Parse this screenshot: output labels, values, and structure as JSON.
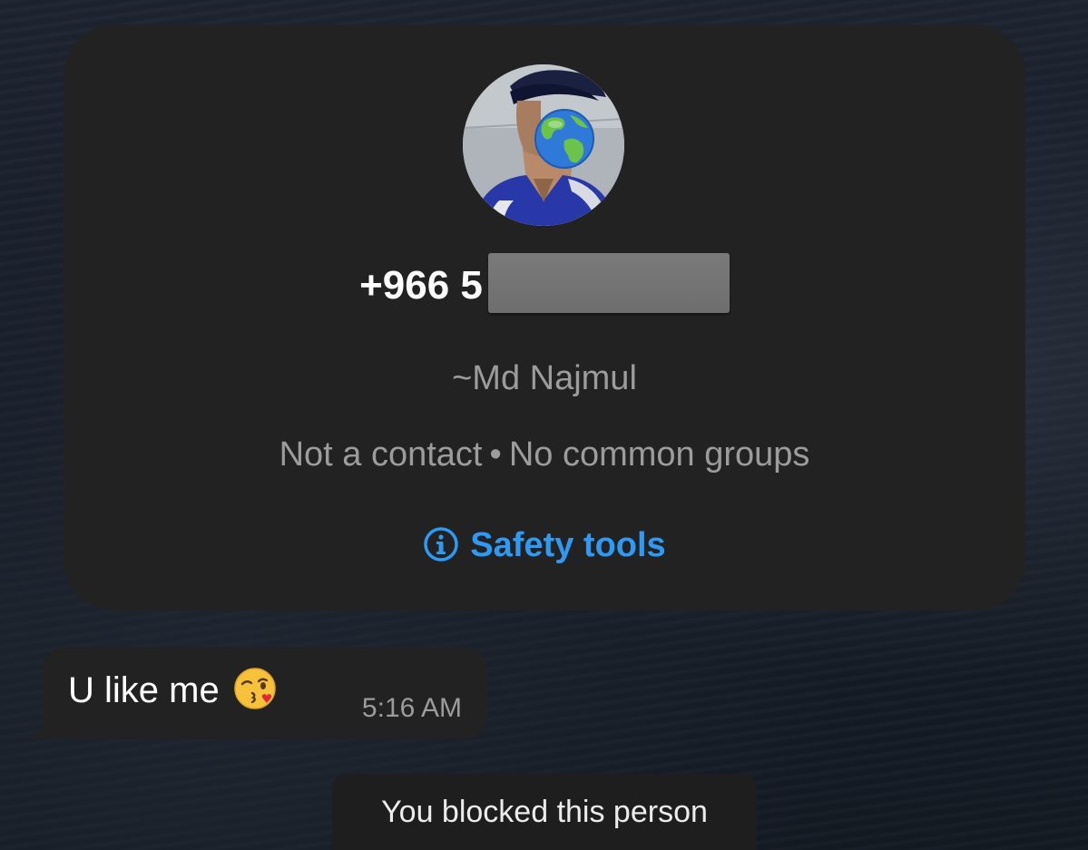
{
  "contact_card": {
    "phone_visible": "+966 5",
    "push_name": "~Md Najmul",
    "not_contact": "Not a contact",
    "separator": "•",
    "common_groups": "No common groups",
    "safety_tools_label": "Safety tools",
    "accent_color": "#2e9af3",
    "avatar_overlay_icon": "earth-globe-emoji"
  },
  "message": {
    "text": "U like me",
    "emoji": "face-blowing-kiss-emoji",
    "time": "5:16 AM"
  },
  "system_notice": {
    "text": "You blocked this person"
  }
}
